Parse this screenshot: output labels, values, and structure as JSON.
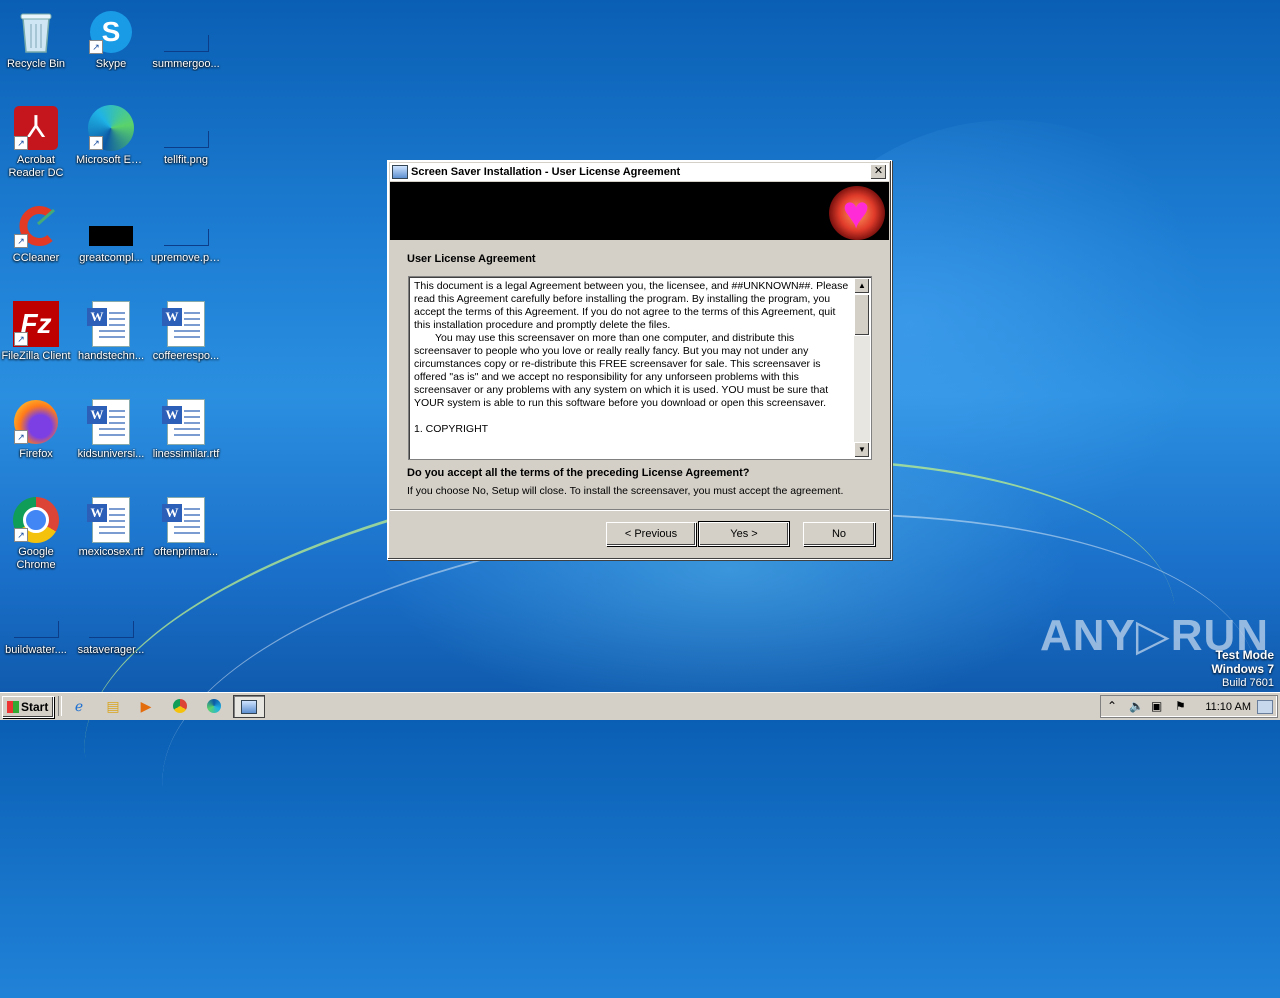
{
  "desktop": {
    "icons": [
      {
        "label": "Recycle Bin"
      },
      {
        "label": "Skype"
      },
      {
        "label": "summergoo..."
      },
      {
        "label": "Acrobat Reader DC"
      },
      {
        "label": "Microsoft Edge"
      },
      {
        "label": "tellfit.png"
      },
      {
        "label": "CCleaner"
      },
      {
        "label": "greatcompl..."
      },
      {
        "label": "upremove.png"
      },
      {
        "label": "FileZilla Client"
      },
      {
        "label": "handstechn..."
      },
      {
        "label": "coffeerespo..."
      },
      {
        "label": "Firefox"
      },
      {
        "label": "kidsuniversi..."
      },
      {
        "label": "linessimilar.rtf"
      },
      {
        "label": "Google Chrome"
      },
      {
        "label": "mexicosex.rtf"
      },
      {
        "label": "oftenprimar..."
      },
      {
        "label": "buildwater...."
      },
      {
        "label": "sataverager..."
      }
    ]
  },
  "dialog": {
    "title": "Screen Saver Installation - User License Agreement",
    "close_glyph": "✕",
    "section_title": "User License Agreement",
    "license_paragraphs": [
      "This document is a legal Agreement between you, the licensee, and ##UNKNOWN##. Please read this Agreement carefully before installing the program. By installing the program, you accept the terms of this Agreement. If you do not agree to the terms of this Agreement, quit this installation procedure and promptly delete the files.",
      "You may use this screensaver on more than one computer, and distribute this screensaver to people who you love or really really fancy. But you may not under any circumstances copy or re-distribute this FREE screensaver for sale.                    This screensaver is offered \"as is\" and we accept no responsibility for any unforseen problems with this screensaver or any problems with any system on which it is used. YOU must be sure that YOUR system is able to run this software before you download or open this screensaver.",
      "1. COPYRIGHT"
    ],
    "question": "Do you accept all the terms of the preceding License Agreement?",
    "note": "If you choose No, Setup will close. To install the screensaver, you must accept the agreement.",
    "buttons": {
      "previous": "< Previous",
      "yes": "Yes >",
      "no": "No"
    },
    "heart_glyph": "♥"
  },
  "watermark": {
    "brand": "ANY▷RUN",
    "mode_line1": "Test Mode",
    "mode_line2": "Windows 7",
    "build": "Build 7601"
  },
  "taskbar": {
    "start_label": "Start",
    "clock": "11:10 AM",
    "pinned_icons": [
      "internet-explorer-icon",
      "file-explorer-icon",
      "media-player-icon",
      "chrome-icon",
      "edge-icon",
      "installer-icon"
    ]
  }
}
